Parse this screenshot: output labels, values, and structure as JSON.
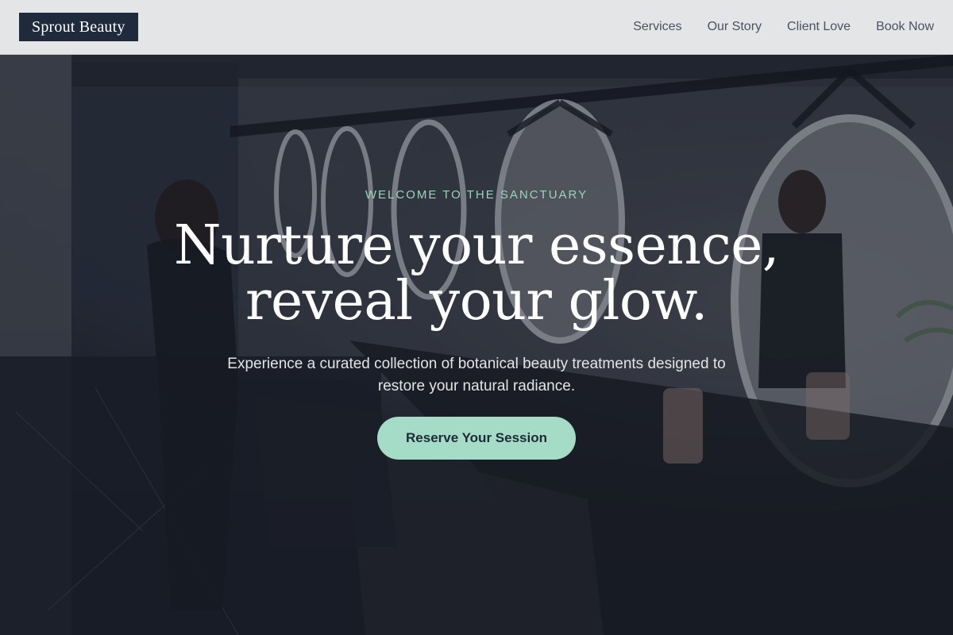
{
  "header": {
    "logo": "Sprout Beauty",
    "nav": [
      {
        "label": "Services"
      },
      {
        "label": "Our Story"
      },
      {
        "label": "Client Love"
      },
      {
        "label": "Book Now"
      }
    ]
  },
  "hero": {
    "eyebrow": "WELCOME TO THE SANCTUARY",
    "headline_line1": "Nurture your essence,",
    "headline_line2": "reveal your glow.",
    "subtext": "Experience a curated collection of botanical beauty treatments designed to restore your natural radiance.",
    "cta_label": "Reserve Your Session",
    "background_image": "salon-interior-photo"
  },
  "colors": {
    "header_bg": "#e4e5e7",
    "logo_bg": "#1f2a3c",
    "accent": "#a4dcc7",
    "eyebrow": "#9bd3be"
  }
}
